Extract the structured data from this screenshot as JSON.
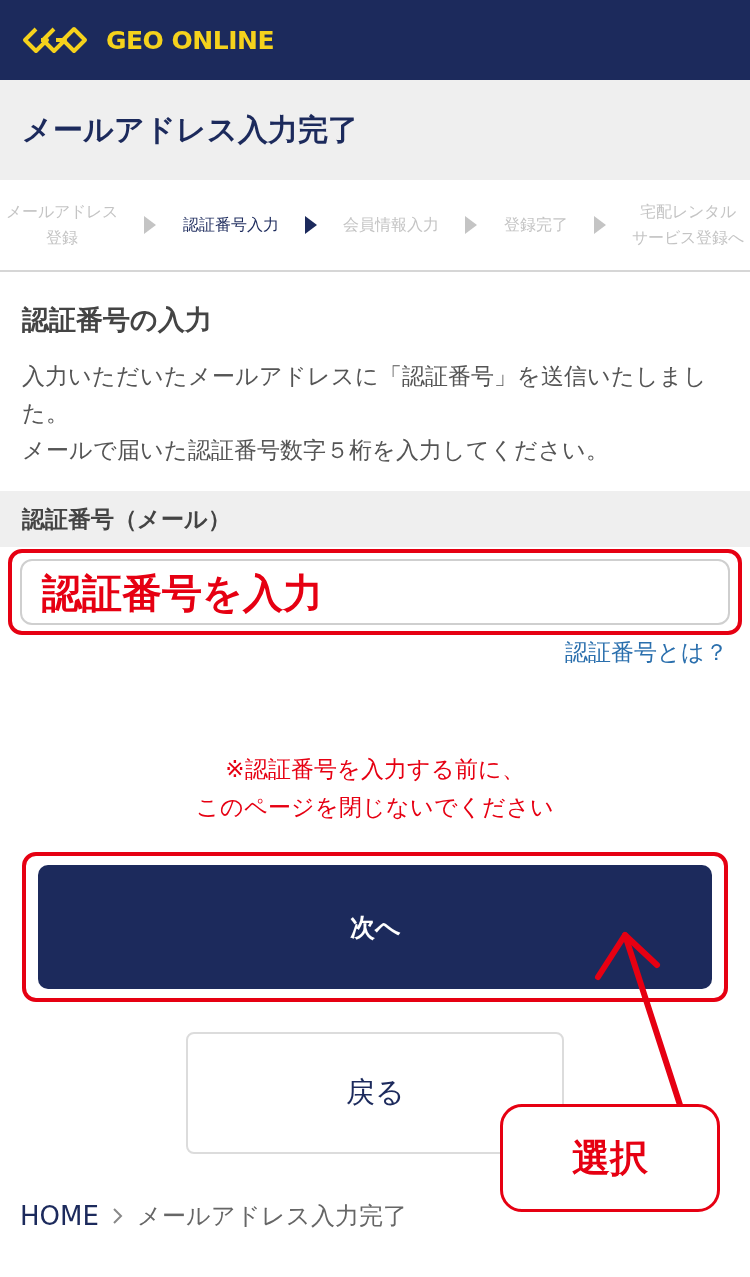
{
  "header": {
    "logo_text": "GEO ONLINE"
  },
  "page_title": "メールアドレス入力完了",
  "steps": [
    {
      "lines": [
        "メールアドレス",
        "登録"
      ],
      "selected": false
    },
    {
      "lines": [
        "認証番号入力"
      ],
      "selected": true
    },
    {
      "lines": [
        "会員情報入力"
      ],
      "selected": false
    },
    {
      "lines": [
        "登録完了"
      ],
      "selected": false
    },
    {
      "lines": [
        "宅配レンタル",
        "サービス登録へ"
      ],
      "selected": false
    }
  ],
  "section_title": "認証番号の入力",
  "description": [
    "入力いただいたメールアドレスに「認証番号」を送信いたしました。",
    "メールで届いた認証番号数字５桁を入力してください。"
  ],
  "field": {
    "label": "認証番号（メール）"
  },
  "help_link": "認証番号とは？",
  "notice": [
    "※認証番号を入力する前に、",
    "このページを閉じないでください"
  ],
  "buttons": [
    {
      "kind": "primary",
      "label": "次へ"
    },
    {
      "kind": "secondary",
      "label": "戻る"
    }
  ],
  "annotations": [
    {
      "kind": "field_note",
      "text": "認証番号を入力"
    },
    {
      "kind": "callout",
      "text": "選択"
    }
  ],
  "breadcrumb": [
    "HOME",
    "メールアドレス入力完了"
  ]
}
